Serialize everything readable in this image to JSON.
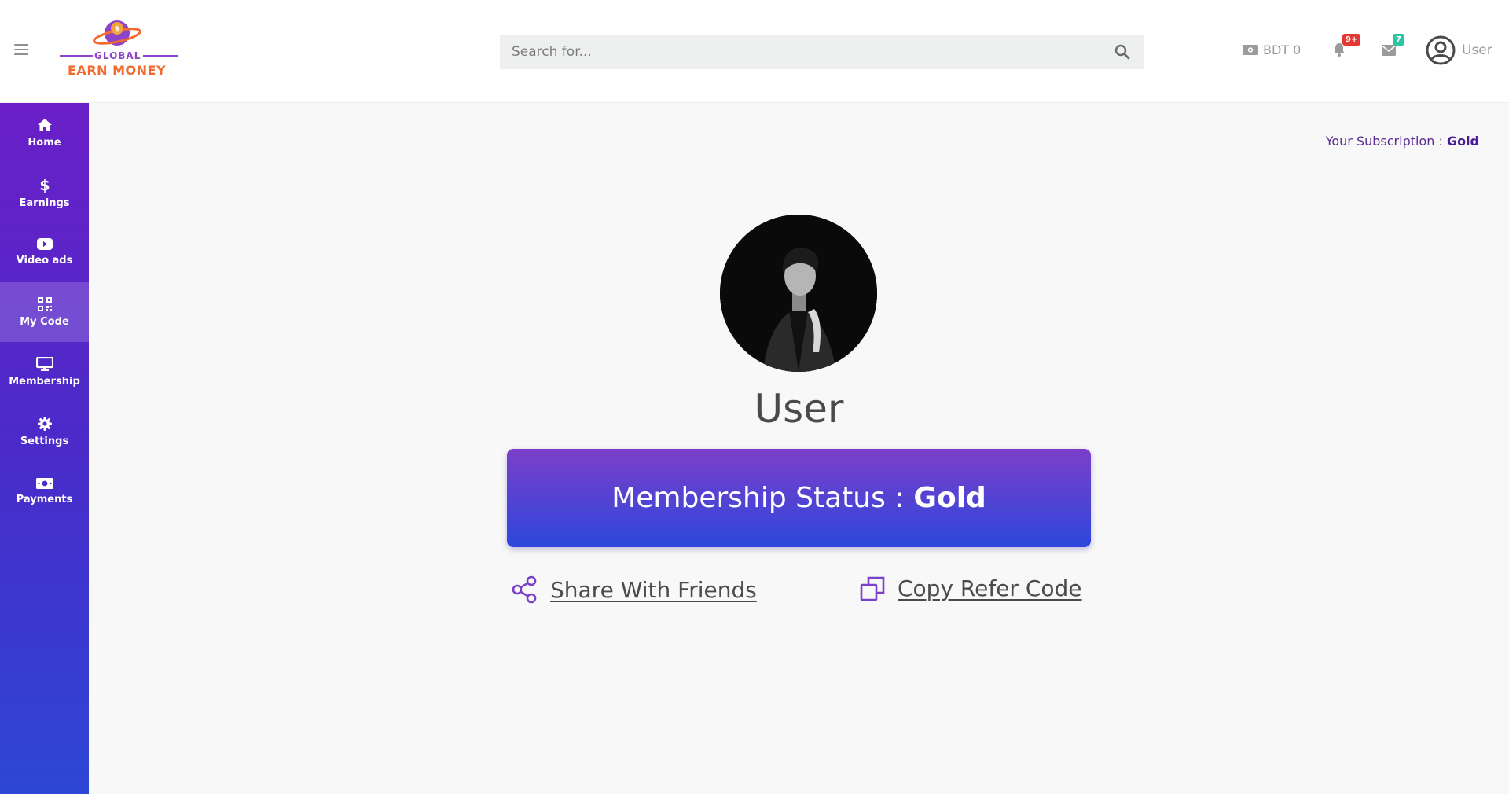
{
  "header": {
    "search_placeholder": "Search for...",
    "balance": "BDT 0",
    "notifications_badge": "9+",
    "messages_badge": "7",
    "user_label": "User"
  },
  "logo": {
    "line1": "GLOBAL",
    "line2": "EARN MONEY"
  },
  "sidebar": {
    "items": [
      {
        "label": "Home",
        "icon": "home-icon"
      },
      {
        "label": "Earnings",
        "icon": "dollar-icon"
      },
      {
        "label": "Video ads",
        "icon": "youtube-icon"
      },
      {
        "label": "My Code",
        "icon": "qr-code-icon",
        "active": true
      },
      {
        "label": "Membership",
        "icon": "monitor-icon"
      },
      {
        "label": "Settings",
        "icon": "gear-icon"
      },
      {
        "label": "Payments",
        "icon": "money-bill-icon"
      }
    ]
  },
  "main": {
    "subscription_label": "Your Subscription : ",
    "subscription_value": "Gold",
    "username": "User",
    "membership_label": "Membership Status :",
    "membership_value": "Gold",
    "share_label": "Share With Friends",
    "copy_label": "Copy Refer Code"
  },
  "colors": {
    "accent_purple": "#7b3fc9",
    "accent_blue": "#2d47dc",
    "notification_badge": "#e53935",
    "message_badge": "#2ec4a0"
  }
}
